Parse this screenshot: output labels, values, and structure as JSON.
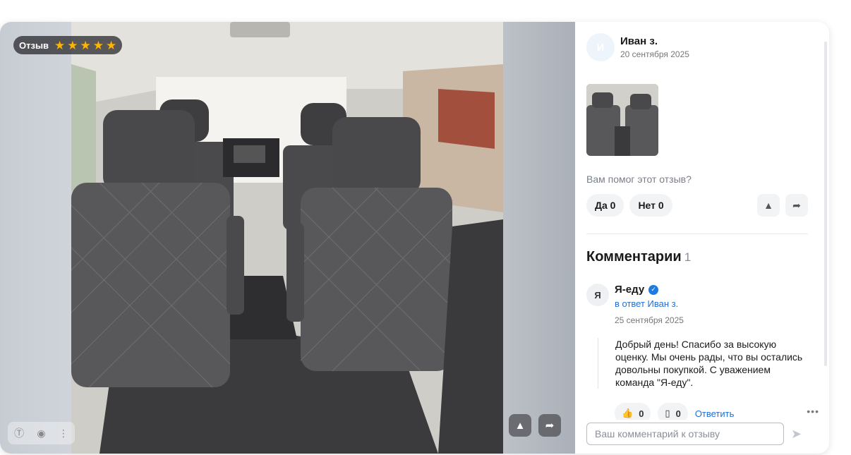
{
  "review": {
    "badge_label": "Отзыв",
    "rating": 5,
    "stars": [
      "★",
      "★",
      "★",
      "★",
      "★"
    ],
    "author_initial": "И",
    "author": "Иван з.",
    "date": "20 сентября 2025"
  },
  "helpful": {
    "question": "Вам помог этот отзыв?",
    "yes_label": "Да 0",
    "no_label": "Нет 0"
  },
  "comments": {
    "title": "Комментарии",
    "count": "1",
    "items": [
      {
        "initial": "Я",
        "name": "Я-еду",
        "reply_to": "в ответ Иван з.",
        "date": "25 сентября 2025",
        "text": "Добрый день! Спасибо за высокую оценку. Мы очень рады, что вы остались довольны покупкой. С уважением команда \"Я-еду\".",
        "likes": "0",
        "reply_count": "0",
        "reply_label": "Ответить"
      }
    ],
    "input_placeholder": "Ваш комментарий к отзыву"
  },
  "icons": {
    "star": "star-icon",
    "warning": "warning-icon",
    "share": "share-icon",
    "verified": "verified-icon",
    "send": "send-icon"
  },
  "colors": {
    "accent_blue": "#1f6fd8",
    "star": "#ffb400"
  }
}
